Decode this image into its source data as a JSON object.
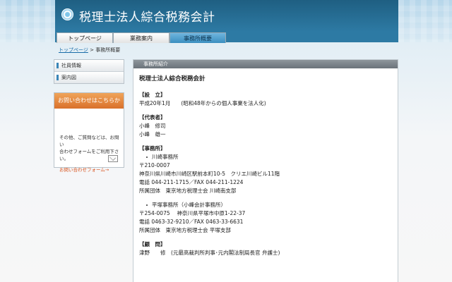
{
  "site": {
    "title": "税理士法人綜合税務会計"
  },
  "nav": {
    "tabs": [
      "トップページ",
      "業務案内",
      "事務所概要"
    ]
  },
  "breadcrumb": {
    "home": "トップページ",
    "sep": " > ",
    "current": "事務所概要"
  },
  "sidebar": {
    "items": [
      "社員情報",
      "案内図"
    ],
    "contact": {
      "heading": "お問い合わせはこちらから",
      "text1": "その他、ご質問などは、お問い",
      "text2": "合わせフォームをご利用下さい。",
      "link": "お問い合わせフォーム→"
    }
  },
  "main": {
    "section_title": "事務所紹介",
    "company": "税理士法人綜合税務会計",
    "est_heading": "【設　立】",
    "est_text": "平成20年1月　　(昭和48年からの個人事業を法人化)",
    "rep_heading": "【代表者】",
    "rep1": "小峰　修司",
    "rep2": "小峰　雄一",
    "office_heading": "【事務所】",
    "office1_name": "川崎事務所",
    "office1_zip": "〒210-0007",
    "office1_addr": "神奈川県川崎市川崎区駅前本町10-5　クリエ川崎ビル11階",
    "office1_tel": "電話 044-211-1715／FAX 044-211-1224",
    "office1_group": "所属団体　東京地方税理士会 川崎南支部",
    "office2_name": "平塚事務所（小峰会計事務所）",
    "office2_addr": "〒254-0075　 神奈川県平塚市中原1-22-37",
    "office2_tel": " 電話 0463-32-9210／FAX 0463-33-6631",
    "office2_group": " 所属団体　東京地方税理士会 平塚支部",
    "adv_heading": "【顧　問】",
    "adv1": "津野　　修　(元最高裁判所判事･元内閣法制局長官 弁護士)"
  }
}
